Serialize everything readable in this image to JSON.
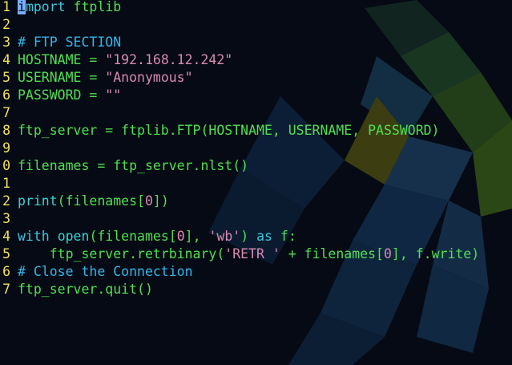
{
  "editor": {
    "lines": [
      {
        "num": "1",
        "tokens": [
          {
            "t": "i",
            "c": "cursor"
          },
          {
            "t": "mport",
            "c": "kw"
          },
          {
            "t": " ftplib",
            "c": "tx"
          }
        ]
      },
      {
        "num": "2",
        "tokens": []
      },
      {
        "num": "3",
        "tokens": [
          {
            "t": "# FTP SECTION",
            "c": "cm"
          }
        ]
      },
      {
        "num": "4",
        "tokens": [
          {
            "t": "HOSTNAME = ",
            "c": "tx"
          },
          {
            "t": "\"192.168.12.242\"",
            "c": "st"
          }
        ]
      },
      {
        "num": "5",
        "tokens": [
          {
            "t": "USERNAME = ",
            "c": "tx"
          },
          {
            "t": "\"Anonymous\"",
            "c": "st"
          }
        ]
      },
      {
        "num": "6",
        "tokens": [
          {
            "t": "PASSWORD = ",
            "c": "tx"
          },
          {
            "t": "\"\"",
            "c": "st"
          }
        ]
      },
      {
        "num": "7",
        "tokens": []
      },
      {
        "num": "8",
        "tokens": [
          {
            "t": "ftp_server = ftplib.FTP(HOSTNAME, USERNAME, PASSWORD)",
            "c": "tx"
          }
        ]
      },
      {
        "num": "9",
        "tokens": []
      },
      {
        "num": "0",
        "tokens": [
          {
            "t": "filenames = ftp_server.nlst()",
            "c": "tx"
          }
        ]
      },
      {
        "num": "1",
        "tokens": []
      },
      {
        "num": "2",
        "tokens": [
          {
            "t": "print",
            "c": "fn"
          },
          {
            "t": "(filenames[",
            "c": "tx"
          },
          {
            "t": "0",
            "c": "nm"
          },
          {
            "t": "])",
            "c": "tx"
          }
        ]
      },
      {
        "num": "3",
        "tokens": []
      },
      {
        "num": "4",
        "tokens": [
          {
            "t": "with",
            "c": "kw"
          },
          {
            "t": " ",
            "c": "tx"
          },
          {
            "t": "open",
            "c": "fn"
          },
          {
            "t": "(filenames[",
            "c": "tx"
          },
          {
            "t": "0",
            "c": "nm"
          },
          {
            "t": "], ",
            "c": "tx"
          },
          {
            "t": "'wb'",
            "c": "st"
          },
          {
            "t": ") ",
            "c": "tx"
          },
          {
            "t": "as",
            "c": "kw"
          },
          {
            "t": " f:",
            "c": "tx"
          }
        ]
      },
      {
        "num": "5",
        "tokens": [
          {
            "t": "    ftp_server.retrbinary(",
            "c": "tx"
          },
          {
            "t": "'RETR '",
            "c": "st"
          },
          {
            "t": " + filenames[",
            "c": "tx"
          },
          {
            "t": "0",
            "c": "nm"
          },
          {
            "t": "], f.write)",
            "c": "tx"
          }
        ]
      },
      {
        "num": "6",
        "tokens": [
          {
            "t": "# Close the Connection",
            "c": "cm"
          }
        ]
      },
      {
        "num": "7",
        "tokens": [
          {
            "t": "ftp_server.quit()",
            "c": "tx"
          }
        ]
      }
    ]
  },
  "colors": {
    "background": "#050a14",
    "line_numbers": "#f5e15a",
    "keyword": "#3cc7e0",
    "comment": "#33b6e8",
    "string": "#d98ab0",
    "text": "#4fe04f",
    "cursor": "#7ab0ff"
  },
  "wallpaper": {
    "icon": "parrot-wallpaper-icon"
  }
}
